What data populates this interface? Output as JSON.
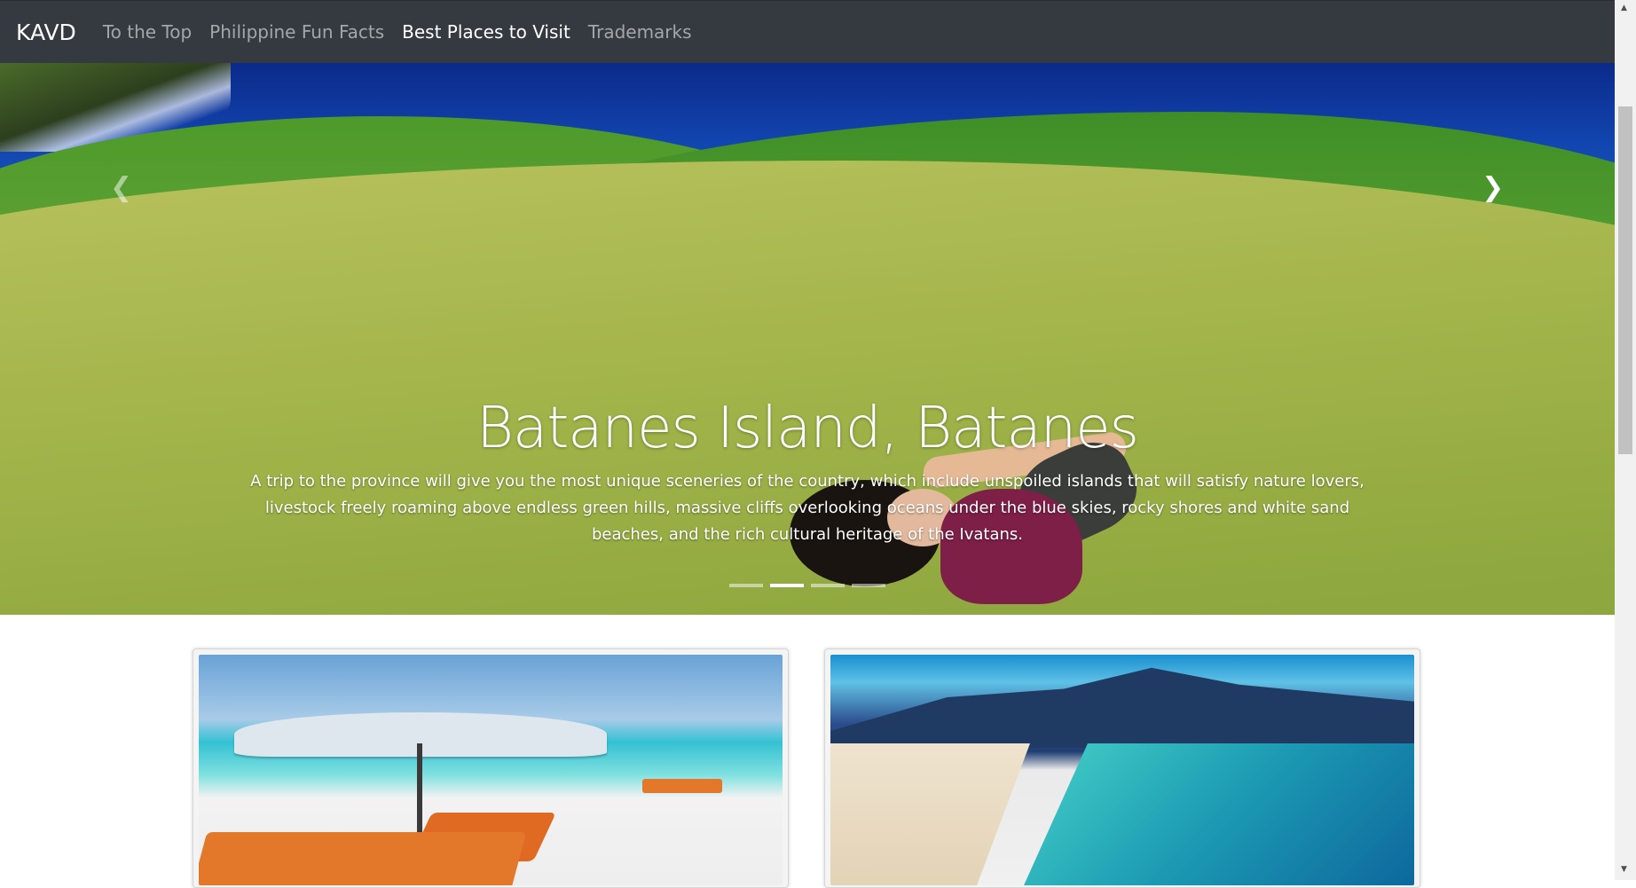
{
  "navbar": {
    "brand": "KAVD",
    "links": [
      {
        "label": "To the Top",
        "active": false
      },
      {
        "label": "Philippine Fun Facts",
        "active": false
      },
      {
        "label": "Best Places to Visit",
        "active": true
      },
      {
        "label": "Trademarks",
        "active": false
      }
    ]
  },
  "carousel": {
    "active_slide": 2,
    "slide_count": 4,
    "caption": {
      "title": "Batanes Island, Batanes",
      "text": "A trip to the province will give you the most unique sceneries of the country, which include unspoiled islands that will satisfy nature lovers, livestock freely roaming above endless green hills, massive cliffs overlooking oceans under the blue skies, rocky shores and white sand beaches, and the rich cultural heritage of the Ivatans."
    },
    "prev_icon": "chevron-left-icon",
    "next_icon": "chevron-right-icon"
  },
  "cards": [
    {
      "image": "beach-umbrella-loungers"
    },
    {
      "image": "white-sand-island-mountain"
    }
  ],
  "colors": {
    "navbar_bg": "#343a40",
    "nav_inactive": "rgba(255,255,255,0.55)",
    "nav_active": "#ffffff"
  }
}
